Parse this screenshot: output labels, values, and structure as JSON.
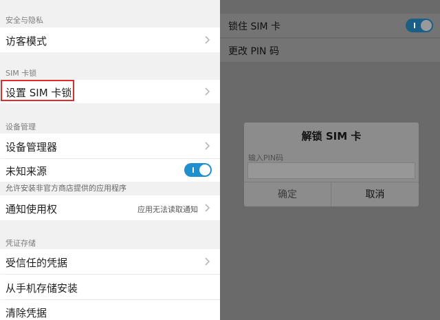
{
  "left": {
    "sections": {
      "security": "安全与隐私",
      "sim_lock": "SIM 卡锁",
      "device_mgmt": "设备管理",
      "credential_storage": "凭证存储"
    },
    "items": {
      "guest_mode": "访客模式",
      "set_sim_lock": "设置 SIM 卡锁",
      "device_manager": "设备管理器",
      "unknown_sources": "未知来源",
      "unknown_sources_desc": "允许安装非官方商店提供的应用程序",
      "notification_access": "通知使用权",
      "notification_access_value": "应用无法读取通知",
      "trusted_credentials": "受信任的凭据",
      "install_from_storage": "从手机存储安装",
      "clear_credentials": "清除凭据"
    },
    "unknown_sources_enabled": true
  },
  "right": {
    "lock_sim": "锁住 SIM 卡",
    "lock_sim_enabled": true,
    "change_pin": "更改 PIN 码",
    "dialog": {
      "title": "解锁 SIM 卡",
      "hint": "输入PIN码",
      "input_value": "",
      "ok": "确定",
      "cancel": "取消"
    }
  },
  "colors": {
    "accent": "#1e8fcf",
    "highlight": "#e02b2b",
    "overlay": "#6a6a6a"
  }
}
